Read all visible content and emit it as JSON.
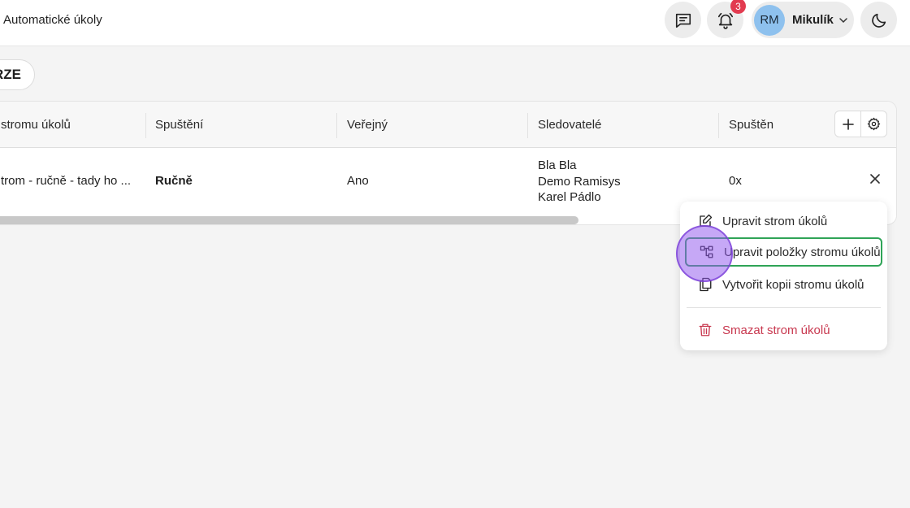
{
  "header": {
    "title": "Automatické úkoly",
    "notifications_count": "3",
    "user": {
      "initials": "RM",
      "name": "Mikulík"
    }
  },
  "filter": {
    "label": "RZE"
  },
  "table": {
    "columns": [
      "stromu úkolů",
      "Spuštění",
      "Veřejný",
      "Sledovatelé",
      "Spuštěn"
    ],
    "rows": [
      {
        "name": "trom - ručně - tady ho ...",
        "trigger": "Ručně",
        "public": "Ano",
        "followers": [
          "Bla Bla",
          "Demo Ramisys",
          "Karel Pádlo"
        ],
        "run_count": "0x"
      }
    ]
  },
  "context_menu": {
    "items": [
      {
        "label": "Upravit strom úkolů",
        "icon": "edit-icon"
      },
      {
        "label": "Upravit položky stromu úkolů",
        "icon": "tree-structure-icon"
      },
      {
        "label": "Vytvořit kopii stromu úkolů",
        "icon": "copy-icon"
      },
      {
        "label": "Smazat strom úkolů",
        "icon": "trash-icon"
      }
    ]
  },
  "colors": {
    "accent_green": "#2fa457",
    "danger": "#c8384f",
    "badge": "#e23b50",
    "avatar": "#8ec1ee",
    "cursor": "#9258ee"
  }
}
